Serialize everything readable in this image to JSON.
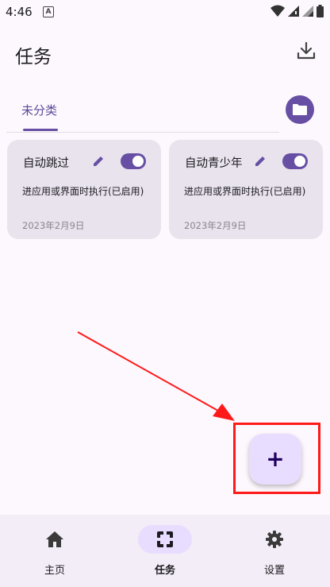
{
  "status_bar": {
    "time": "4:46",
    "a_label": "A"
  },
  "app_bar": {
    "title": "任务"
  },
  "tabs": [
    {
      "label": "未分类"
    }
  ],
  "cards": [
    {
      "name": "自动跳过",
      "description": "进应用或界面时执行(已启用)",
      "date": "2023年2月9日",
      "enabled": true
    },
    {
      "name": "自动青少年",
      "description": "进应用或界面时执行(已启用)",
      "date": "2023年2月9日",
      "enabled": true
    }
  ],
  "fab": {
    "label": "+"
  },
  "bottom_nav": [
    {
      "label": "主页",
      "icon": "home-icon",
      "active": false
    },
    {
      "label": "任务",
      "icon": "task-icon",
      "active": true
    },
    {
      "label": "设置",
      "icon": "gear-icon",
      "active": false
    }
  ],
  "colors": {
    "primary": "#6750a4",
    "fab": "#e9ddff",
    "card": "#e9e3ee",
    "annotation": "#ff1a1a"
  }
}
